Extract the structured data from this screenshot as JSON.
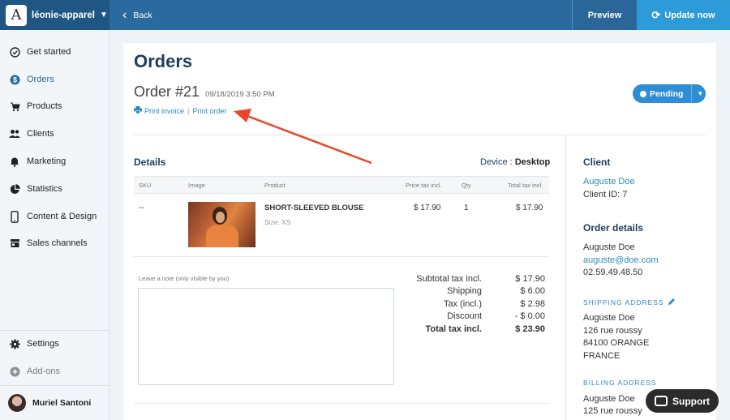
{
  "topbar": {
    "store_logo": "A",
    "store_name": "léonie-apparel",
    "back_label": "Back",
    "preview_label": "Preview",
    "update_label": "Update now"
  },
  "sidebar": {
    "items": [
      {
        "label": "Get started",
        "icon": "check-circle-icon"
      },
      {
        "label": "Orders",
        "icon": "dollar-circle-icon"
      },
      {
        "label": "Products",
        "icon": "cart-icon"
      },
      {
        "label": "Clients",
        "icon": "people-icon"
      },
      {
        "label": "Marketing",
        "icon": "bell-icon"
      },
      {
        "label": "Statistics",
        "icon": "pie-chart-icon"
      },
      {
        "label": "Content & Design",
        "icon": "phone-icon"
      },
      {
        "label": "Sales channels",
        "icon": "store-icon"
      }
    ],
    "settings_label": "Settings",
    "addons_label": "Add-ons",
    "user_name": "Muriel Santoni"
  },
  "page": {
    "title": "Orders",
    "order_number": "Order #21",
    "order_date": "09/18/2019 3:50 PM",
    "print_invoice": "Print invoice",
    "print_separator": "|",
    "print_order": "Print order",
    "status": "Pending"
  },
  "details": {
    "title": "Details",
    "device_label": "Device :",
    "device_value": "Desktop",
    "columns": [
      "SKU",
      "Image",
      "Product",
      "Price tax incl.",
      "Qty",
      "Total tax incl."
    ],
    "row": {
      "sku": "--",
      "product": "SHORT-SLEEVED BLOUSE",
      "size": "Size: XS",
      "price": "$ 17.90",
      "qty": "1",
      "total": "$ 17.90"
    },
    "note_placeholder": "Leave a note (only visible by you)",
    "totals": [
      {
        "label": "Subtotal tax incl.",
        "value": "$ 17.90"
      },
      {
        "label": "Shipping",
        "value": "$ 6.00"
      },
      {
        "label": "Tax (incl.)",
        "value": "$ 2.98"
      },
      {
        "label": "Discount",
        "value": "- $ 0.00"
      },
      {
        "label": "Total tax incl.",
        "value": "$ 23.90"
      }
    ]
  },
  "client": {
    "title": "Client",
    "name": "Auguste Doe",
    "id_text": "Client ID: 7"
  },
  "order_details": {
    "title": "Order details",
    "name": "Auguste Doe",
    "email": "auguste@doe.com",
    "phone": "02.59.49.48.50",
    "shipping_caption": "SHIPPING ADDRESS",
    "shipping": [
      "Auguste Doe",
      "126 rue roussy",
      "84100 ORANGE",
      "FRANCE"
    ],
    "billing_caption": "BILLING ADDRESS",
    "billing": [
      "Auguste Doe",
      "125 rue roussy"
    ]
  },
  "support_label": "Support",
  "colors": {
    "brand": "#2a6a9e",
    "accent": "#2d9bd8",
    "arrow": "#e8472a"
  }
}
